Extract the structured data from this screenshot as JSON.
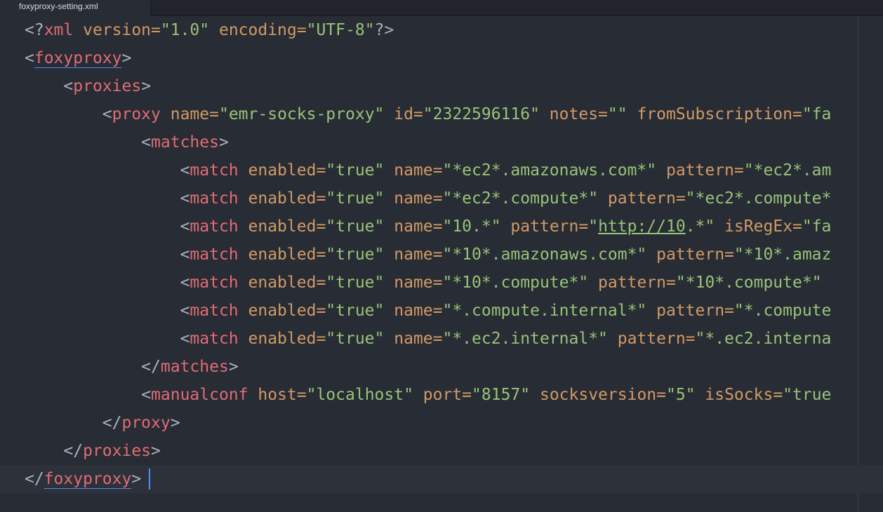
{
  "tab": {
    "title": "foxyproxy-setting.xml"
  },
  "code": {
    "decl_open": "<?",
    "decl_tag": "xml",
    "decl_version_attr": " version=",
    "decl_version_val": "\"1.0\"",
    "decl_encoding_attr": " encoding=",
    "decl_encoding_val": "\"UTF-8\"",
    "decl_close": "?>",
    "foxyproxy_tag": "foxyproxy",
    "proxies_tag": "proxies",
    "proxy_tag": "proxy",
    "proxy_attrs": [
      {
        "name": " name=",
        "value": "\"emr-socks-proxy\""
      },
      {
        "name": " id=",
        "value": "\"2322596116\""
      },
      {
        "name": " notes=",
        "value": "\"\""
      },
      {
        "name": " fromSubscription=",
        "value": "\"fa"
      }
    ],
    "matches_tag": "matches",
    "match_tag": "match",
    "match_rows": [
      {
        "enabled_attr": " enabled=",
        "enabled_val": "\"true\"",
        "name_attr": " name=",
        "name_val": "\"*ec2*.amazonaws.com*\"",
        "next_attr": " pattern=",
        "next_val": "\"*ec2*.am"
      },
      {
        "enabled_attr": " enabled=",
        "enabled_val": "\"true\"",
        "name_attr": " name=",
        "name_val": "\"*ec2*.compute*\"",
        "next_attr": " pattern=",
        "next_val": "\"*ec2*.compute*"
      },
      {
        "enabled_attr": " enabled=",
        "enabled_val": "\"true\"",
        "name_attr": " name=",
        "name_val": "\"10.*\"",
        "next_attr": " pattern=",
        "next_val": "\"",
        "link": "http://10",
        "after_link": ".*\"",
        "extra_attr": " isRegEx=",
        "extra_val": "\"fa"
      },
      {
        "enabled_attr": " enabled=",
        "enabled_val": "\"true\"",
        "name_attr": " name=",
        "name_val": "\"*10*.amazonaws.com*\"",
        "next_attr": " pattern=",
        "next_val": "\"*10*.amaz"
      },
      {
        "enabled_attr": " enabled=",
        "enabled_val": "\"true\"",
        "name_attr": " name=",
        "name_val": "\"*10*.compute*\"",
        "next_attr": " pattern=",
        "next_val": "\"*10*.compute*\""
      },
      {
        "enabled_attr": " enabled=",
        "enabled_val": "\"true\"",
        "name_attr": " name=",
        "name_val": "\"*.compute.internal*\"",
        "next_attr": " pattern=",
        "next_val": "\"*.compute"
      },
      {
        "enabled_attr": " enabled=",
        "enabled_val": "\"true\"",
        "name_attr": " name=",
        "name_val": "\"*.ec2.internal*\"",
        "next_attr": " pattern=",
        "next_val": "\"*.ec2.interna"
      }
    ],
    "manualconf_tag": "manualconf",
    "manualconf_attrs": [
      {
        "name": " host=",
        "value": "\"localhost\""
      },
      {
        "name": " port=",
        "value": "\"8157\""
      },
      {
        "name": " socksversion=",
        "value": "\"5\""
      },
      {
        "name": " isSocks=",
        "value": "\"true"
      }
    ],
    "lt": "<",
    "gt": ">",
    "lt_slash": "</"
  },
  "colors": {
    "background": "#282c34",
    "tag": "#e06c75",
    "attribute": "#d19a66",
    "string": "#98c379",
    "punctuation": "#abb2bf",
    "cursor": "#528bff"
  }
}
